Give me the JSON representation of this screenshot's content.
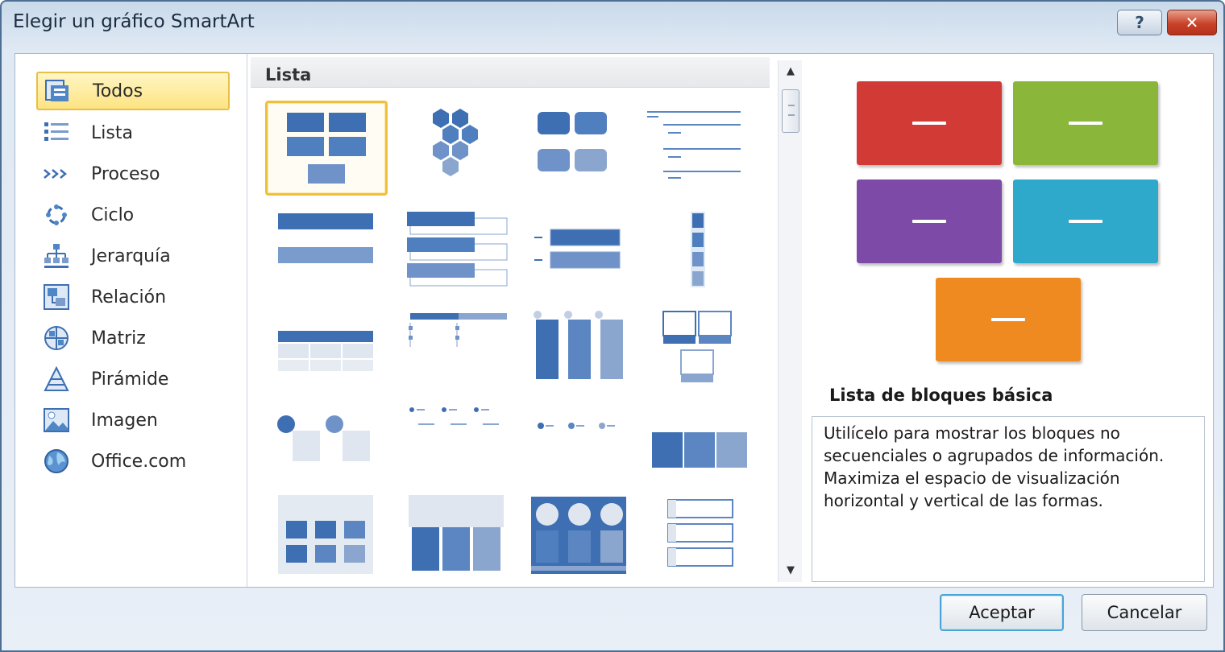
{
  "window": {
    "title": "Elegir un gráfico SmartArt",
    "help_label": "?",
    "close_label": "✕"
  },
  "sidebar": {
    "items": [
      {
        "label": "Todos",
        "icon": "all-icon",
        "selected": true
      },
      {
        "label": "Lista",
        "icon": "list-icon"
      },
      {
        "label": "Proceso",
        "icon": "process-icon"
      },
      {
        "label": "Ciclo",
        "icon": "cycle-icon"
      },
      {
        "label": "Jerarquía",
        "icon": "hierarchy-icon"
      },
      {
        "label": "Relación",
        "icon": "relationship-icon"
      },
      {
        "label": "Matriz",
        "icon": "matrix-icon"
      },
      {
        "label": "Pirámide",
        "icon": "pyramid-icon"
      },
      {
        "label": "Imagen",
        "icon": "picture-icon"
      },
      {
        "label": "Office.com",
        "icon": "office-com-icon"
      }
    ]
  },
  "gallery": {
    "header": "Lista",
    "selected_index": 0,
    "scroll_up": "▲",
    "scroll_down": "▼"
  },
  "preview": {
    "title": "Lista de bloques básica",
    "description": "Utilícelo para mostrar los bloques no secuenciales o agrupados de información. Maximiza el espacio de visualización horizontal y vertical de las formas.",
    "block_colors": [
      "#d23a36",
      "#8ab73a",
      "#7e4aa7",
      "#2ea9cc",
      "#ee8a1f"
    ]
  },
  "buttons": {
    "ok": "Aceptar",
    "cancel": "Cancelar"
  },
  "colors": {
    "accent_blue": "#3d6fb2",
    "light_blue": "#8aa6cf",
    "selection_yellow": "#f0c03c"
  }
}
